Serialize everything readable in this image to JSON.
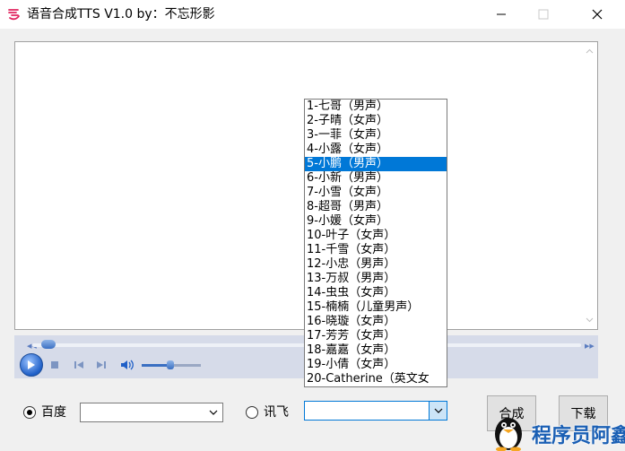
{
  "window": {
    "title": "语音合成TTS V1.0 by：不忘形影"
  },
  "textarea": {
    "value": ""
  },
  "engines": {
    "baidu": {
      "label": "百度",
      "checked": true,
      "voice_value": ""
    },
    "xunfei": {
      "label": "讯飞",
      "checked": false,
      "voice_value": ""
    }
  },
  "voices": [
    "1-七哥（男声）",
    "2-子晴（女声）",
    "3-一菲（女声）",
    "4-小露（女声）",
    "5-小鹏（男声）",
    "6-小新（男声）",
    "7-小雪（女声）",
    "8-超哥（男声）",
    "9-小媛（女声）",
    "10-叶子（女声）",
    "11-千雪（女声）",
    "12-小忠（男声）",
    "13-万叔（男声）",
    "14-虫虫（女声）",
    "15-楠楠（儿童男声）",
    "16-晓璇（女声）",
    "17-芳芳（女声）",
    "18-嘉嘉（女声）",
    "19-小倩（女声）",
    "20-Catherine（英文女"
  ],
  "selected_voice_index": 4,
  "buttons": {
    "synthesize": "合成",
    "download": "下载"
  },
  "watermark": {
    "text": "程序员阿鑫"
  },
  "colors": {
    "selection": "#0078d7",
    "player_bg": "#d6dbe9",
    "watermark": "#1a5fb4"
  }
}
